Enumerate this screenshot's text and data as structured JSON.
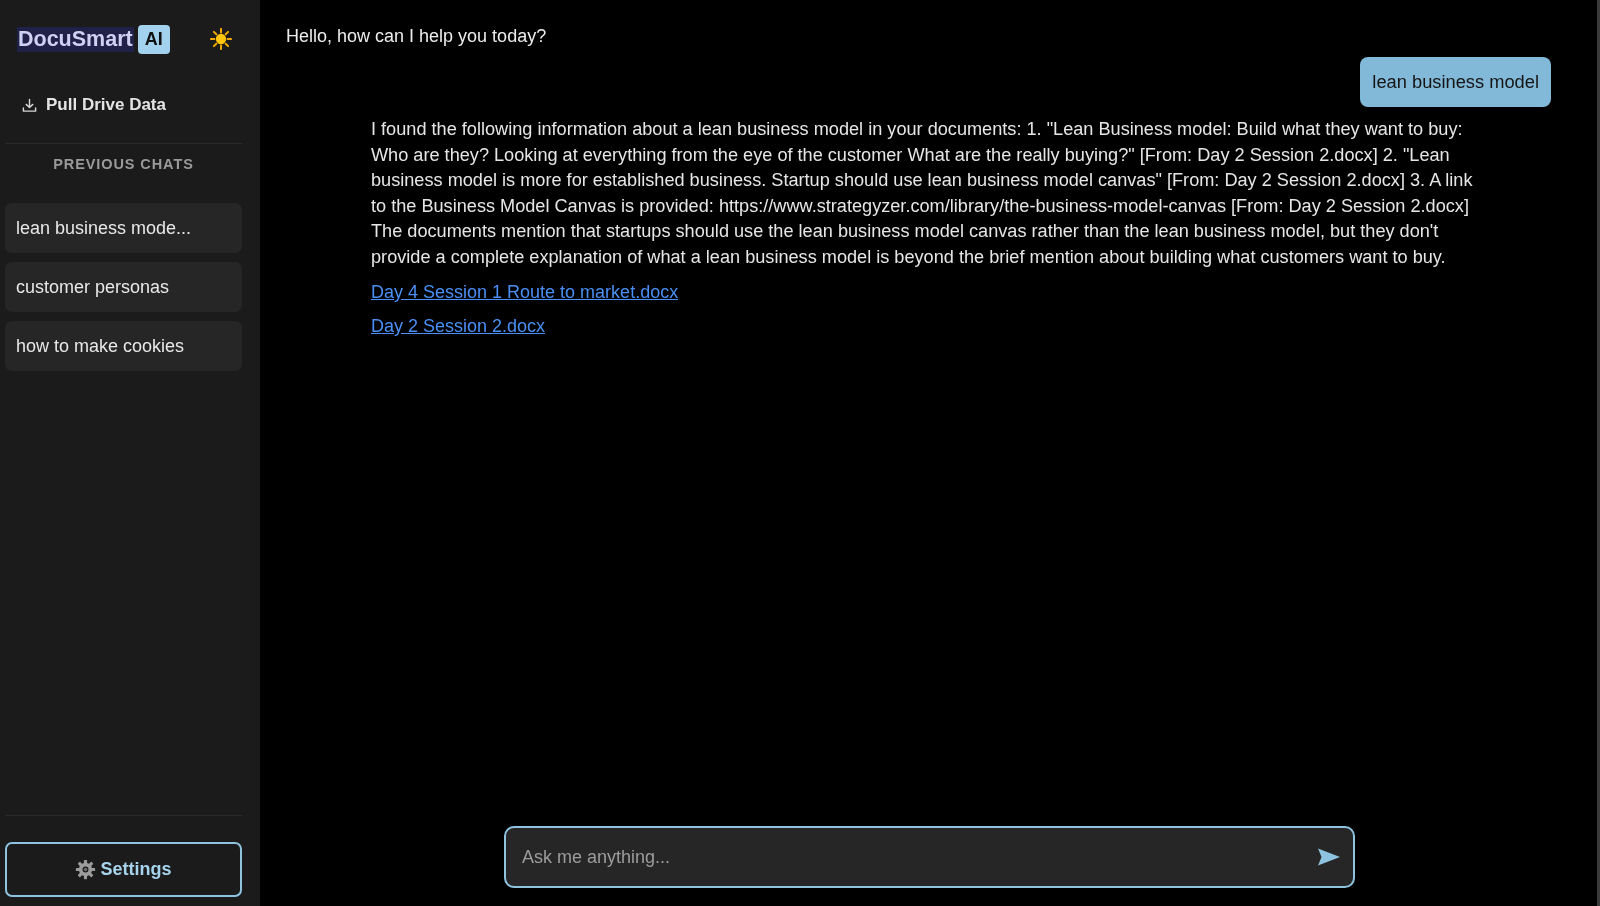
{
  "sidebar": {
    "logo": {
      "name": "DocuSmart",
      "badge": "AI"
    },
    "pull_button": {
      "label": "Pull Drive Data"
    },
    "section_title": "PREVIOUS CHATS",
    "chats": [
      {
        "label": "lean business mode..."
      },
      {
        "label": "customer personas"
      },
      {
        "label": "how to make cookies"
      }
    ],
    "settings_button": {
      "label": "Settings"
    }
  },
  "chat": {
    "messages": [
      {
        "kind": "greeting",
        "text": "Hello, how can I help you today?"
      },
      {
        "kind": "user",
        "text": "lean business model"
      },
      {
        "kind": "answer",
        "text": "I found the following information about a lean business model in your documents: 1. \"Lean Business model: Build what they want to buy: Who are they? Looking at everything from the eye of the customer What are the really buying?\" [From: Day 2 Session 2.docx] 2. \"Lean business model is more for established business. Startup should use lean business model canvas\" [From: Day 2 Session 2.docx] 3. A link to the Business Model Canvas is provided: https://www.strategyzer.com/library/the-business-model-canvas [From: Day 2 Session 2.docx] The documents mention that startups should use the lean business model canvas rather than the lean business model, but they don't provide a complete explanation of what a lean business model is beyond the brief mention about building what customers want to buy.",
        "sources": [
          "Day 4 Session 1 Route to market.docx",
          "Day 2 Session 2.docx"
        ]
      }
    ]
  },
  "composer": {
    "placeholder": "Ask me anything..."
  }
}
